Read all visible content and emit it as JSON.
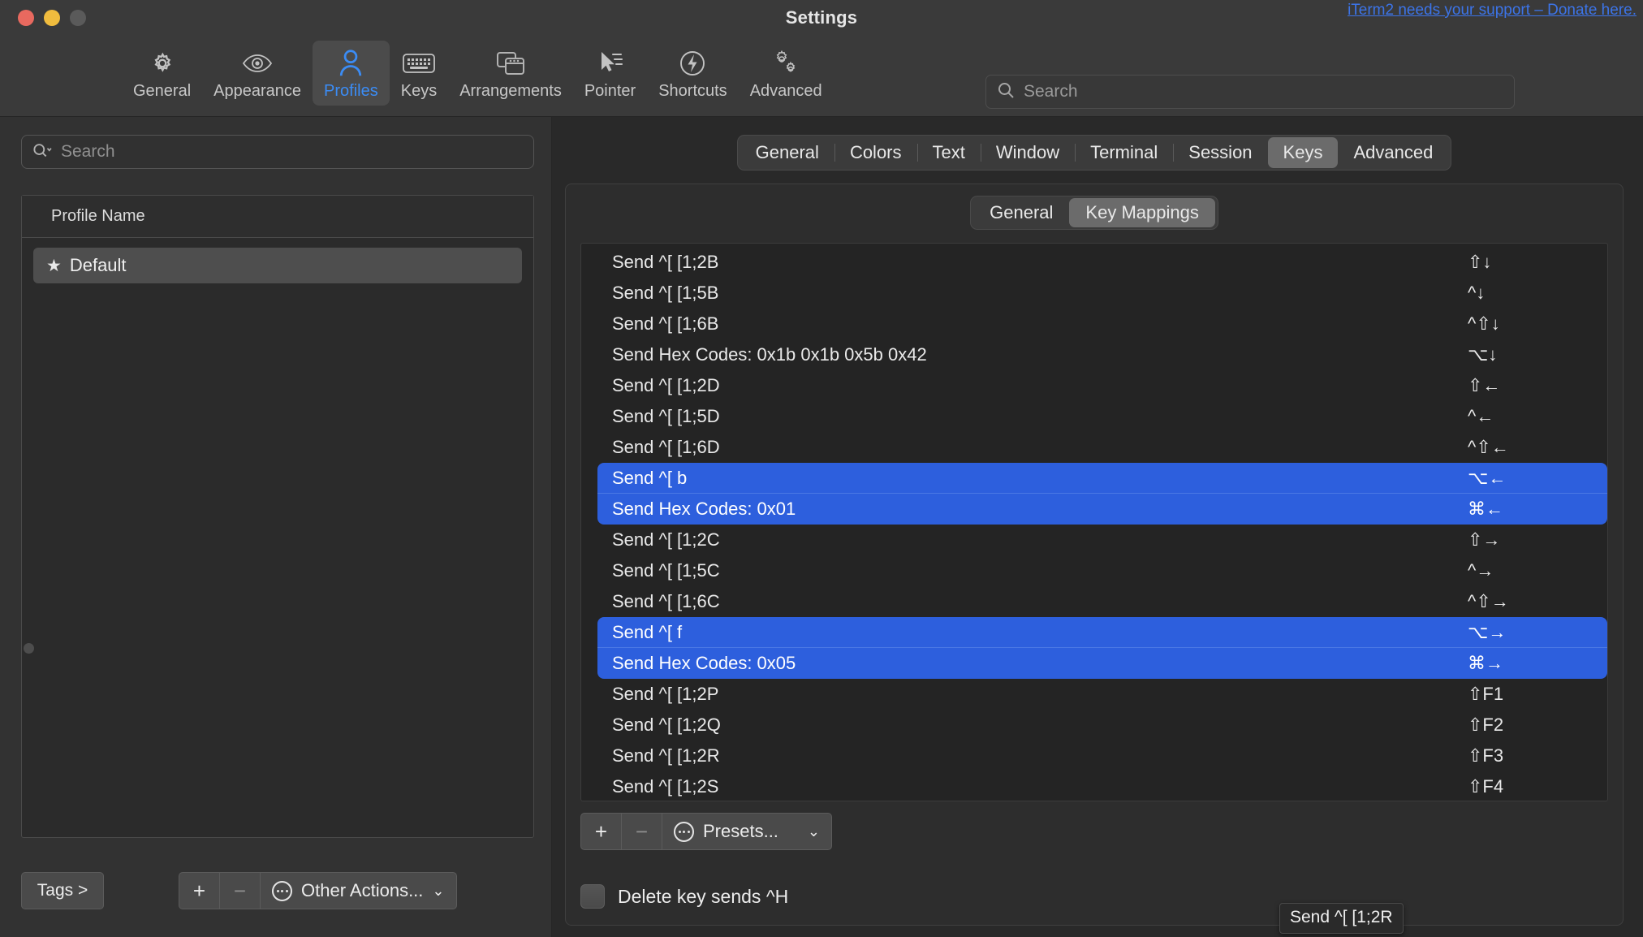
{
  "window": {
    "title": "Settings",
    "donate_link": "iTerm2 needs your support – Donate here.",
    "traffic": {
      "close": "close",
      "minimize": "minimize",
      "zoom": "zoom"
    }
  },
  "toolbar": {
    "items": [
      {
        "label": "General",
        "icon": "gear-icon",
        "active": false
      },
      {
        "label": "Appearance",
        "icon": "eye-icon",
        "active": false
      },
      {
        "label": "Profiles",
        "icon": "person-icon",
        "active": true
      },
      {
        "label": "Keys",
        "icon": "keyboard-icon",
        "active": false
      },
      {
        "label": "Arrangements",
        "icon": "windows-icon",
        "active": false
      },
      {
        "label": "Pointer",
        "icon": "cursor-icon",
        "active": false
      },
      {
        "label": "Shortcuts",
        "icon": "bolt-circle-icon",
        "active": false
      },
      {
        "label": "Advanced",
        "icon": "gears-icon",
        "active": false
      }
    ],
    "search": {
      "placeholder": "Search",
      "value": "",
      "icon": "search-icon"
    }
  },
  "left_pane": {
    "search": {
      "placeholder": "Search",
      "value": "",
      "icon": "search-dropdown-icon"
    },
    "table": {
      "header": "Profile Name",
      "rows": [
        {
          "name": "Default",
          "starred": true,
          "selected": true,
          "star": "★"
        }
      ]
    },
    "bottom": {
      "tags_label": "Tags >",
      "add_label": "+",
      "remove_label": "−",
      "actions_label": "Other Actions...",
      "chevron": "⌄"
    }
  },
  "right_pane": {
    "tabs": [
      {
        "label": "General",
        "active": false
      },
      {
        "label": "Colors",
        "active": false
      },
      {
        "label": "Text",
        "active": false
      },
      {
        "label": "Window",
        "active": false
      },
      {
        "label": "Terminal",
        "active": false
      },
      {
        "label": "Session",
        "active": false
      },
      {
        "label": "Keys",
        "active": true
      },
      {
        "label": "Advanced",
        "active": false
      }
    ],
    "subtabs": [
      {
        "label": "General",
        "active": false
      },
      {
        "label": "Key Mappings",
        "active": true
      }
    ],
    "mappings": [
      {
        "action": "Send ^[ [1;2B",
        "key": "⇧↓",
        "selected": false
      },
      {
        "action": "Send ^[ [1;5B",
        "key": "^↓",
        "selected": false
      },
      {
        "action": "Send ^[ [1;6B",
        "key": "^⇧↓",
        "selected": false
      },
      {
        "action": "Send Hex Codes: 0x1b 0x1b 0x5b 0x42",
        "key": "⌥↓",
        "selected": false
      },
      {
        "action": "Send ^[ [1;2D",
        "key": "⇧←",
        "selected": false
      },
      {
        "action": "Send ^[ [1;5D",
        "key": "^←",
        "selected": false
      },
      {
        "action": "Send ^[ [1;6D",
        "key": "^⇧←",
        "selected": false
      },
      {
        "action": "Send ^[ b",
        "key": "⌥←",
        "selected": true
      },
      {
        "action": "Send Hex Codes: 0x01",
        "key": "⌘←",
        "selected": true
      },
      {
        "action": "Send ^[ [1;2C",
        "key": "⇧→",
        "selected": false
      },
      {
        "action": "Send ^[ [1;5C",
        "key": "^→",
        "selected": false
      },
      {
        "action": "Send ^[ [1;6C",
        "key": "^⇧→",
        "selected": false
      },
      {
        "action": "Send ^[ f",
        "key": "⌥→",
        "selected": true
      },
      {
        "action": "Send Hex Codes: 0x05",
        "key": "⌘→",
        "selected": true
      },
      {
        "action": "Send ^[ [1;2P",
        "key": "⇧F1",
        "selected": false
      },
      {
        "action": "Send ^[ [1;2Q",
        "key": "⇧F2",
        "selected": false
      },
      {
        "action": "Send ^[ [1;2R",
        "key": "⇧F3",
        "selected": false
      },
      {
        "action": "Send ^[ [1;2S",
        "key": "⇧F4",
        "selected": false
      }
    ],
    "tooltip": "Send ^[ [1;2R",
    "bottom": {
      "add_label": "+",
      "remove_label": "−",
      "presets_label": "Presets...",
      "chevron": "⌄",
      "delete_key_label": "Delete key sends ^H",
      "delete_key_checked": false
    }
  },
  "colors": {
    "selection_blue": "#2d5fdd",
    "accent_blue": "#3b8cf5",
    "link_blue": "#3c74e8",
    "window_bg": "#323232",
    "panel_bg": "#2d2d2d",
    "list_bg": "#242424"
  }
}
